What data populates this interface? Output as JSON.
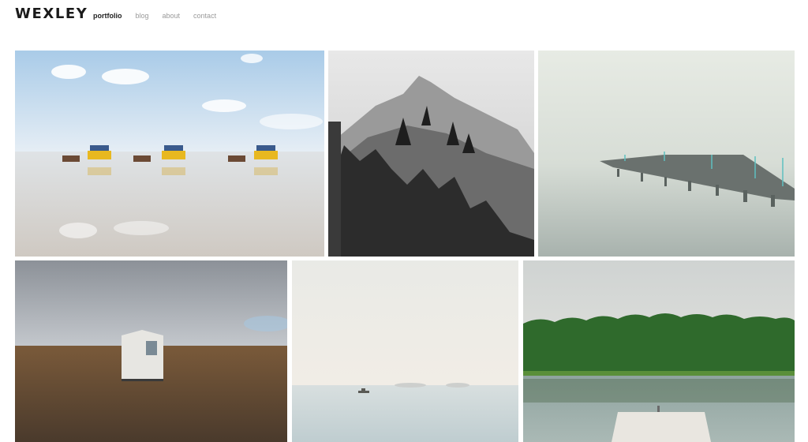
{
  "header": {
    "logo": "WEXLEY",
    "nav": [
      {
        "label": "portfolio",
        "active": true
      },
      {
        "label": "blog",
        "active": false
      },
      {
        "label": "about",
        "active": false
      },
      {
        "label": "contact",
        "active": false
      }
    ]
  },
  "gallery": {
    "tiles": [
      {
        "name": "photo-horse-carriages-on-beach"
      },
      {
        "name": "photo-mountain-cliff-bw"
      },
      {
        "name": "photo-pier-in-fog"
      },
      {
        "name": "photo-white-hut-on-tundra"
      },
      {
        "name": "photo-boat-on-misty-sea"
      },
      {
        "name": "photo-forest-lake-with-dock"
      }
    ]
  }
}
